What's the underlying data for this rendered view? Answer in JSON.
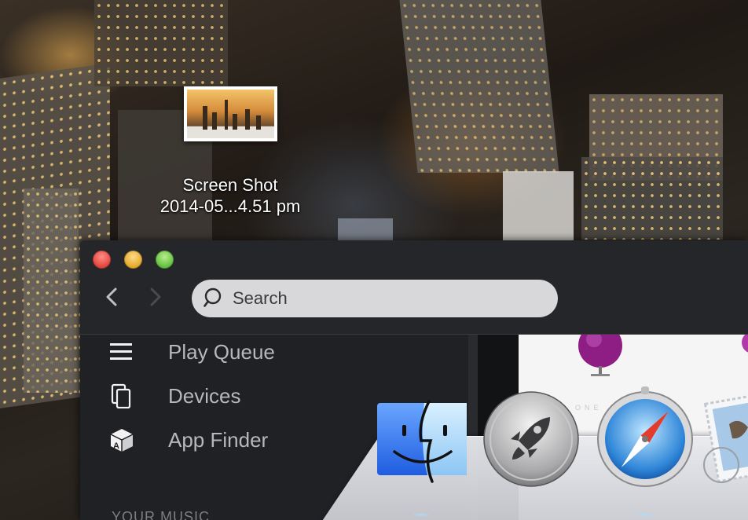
{
  "desktop": {
    "icon": {
      "label_line1": "Screen Shot",
      "label_line2": "2014-05...4.51 pm",
      "thumbnail": "screenshot-thumbnail"
    }
  },
  "window": {
    "traffic_lights": {
      "close_color": "#e0443a",
      "minimize_color": "#e3a825",
      "zoom_color": "#5fbf3c"
    },
    "nav": {
      "back_icon": "chevron-left-icon",
      "forward_icon": "chevron-right-icon"
    },
    "search": {
      "placeholder": "Search",
      "value": "",
      "icon": "search-icon"
    },
    "sidebar": {
      "items": [
        {
          "label": "Play Queue",
          "icon": "play-queue-icon"
        },
        {
          "label": "Devices",
          "icon": "devices-icon"
        },
        {
          "label": "App Finder",
          "icon": "app-finder-icon"
        }
      ],
      "section_header": "YOUR MUSIC"
    },
    "content": {
      "text": "ONE"
    }
  },
  "dock": {
    "items": [
      {
        "name": "Finder",
        "icon": "finder-icon"
      },
      {
        "name": "Launchpad",
        "icon": "launchpad-rocket-icon"
      },
      {
        "name": "Safari",
        "icon": "safari-compass-icon"
      },
      {
        "name": "Mail",
        "icon": "mail-stamp-icon"
      }
    ]
  },
  "colors": {
    "window_bg": "#202124",
    "sidebar_text": "#b7b8bb",
    "search_bg": "#d8d8da"
  }
}
